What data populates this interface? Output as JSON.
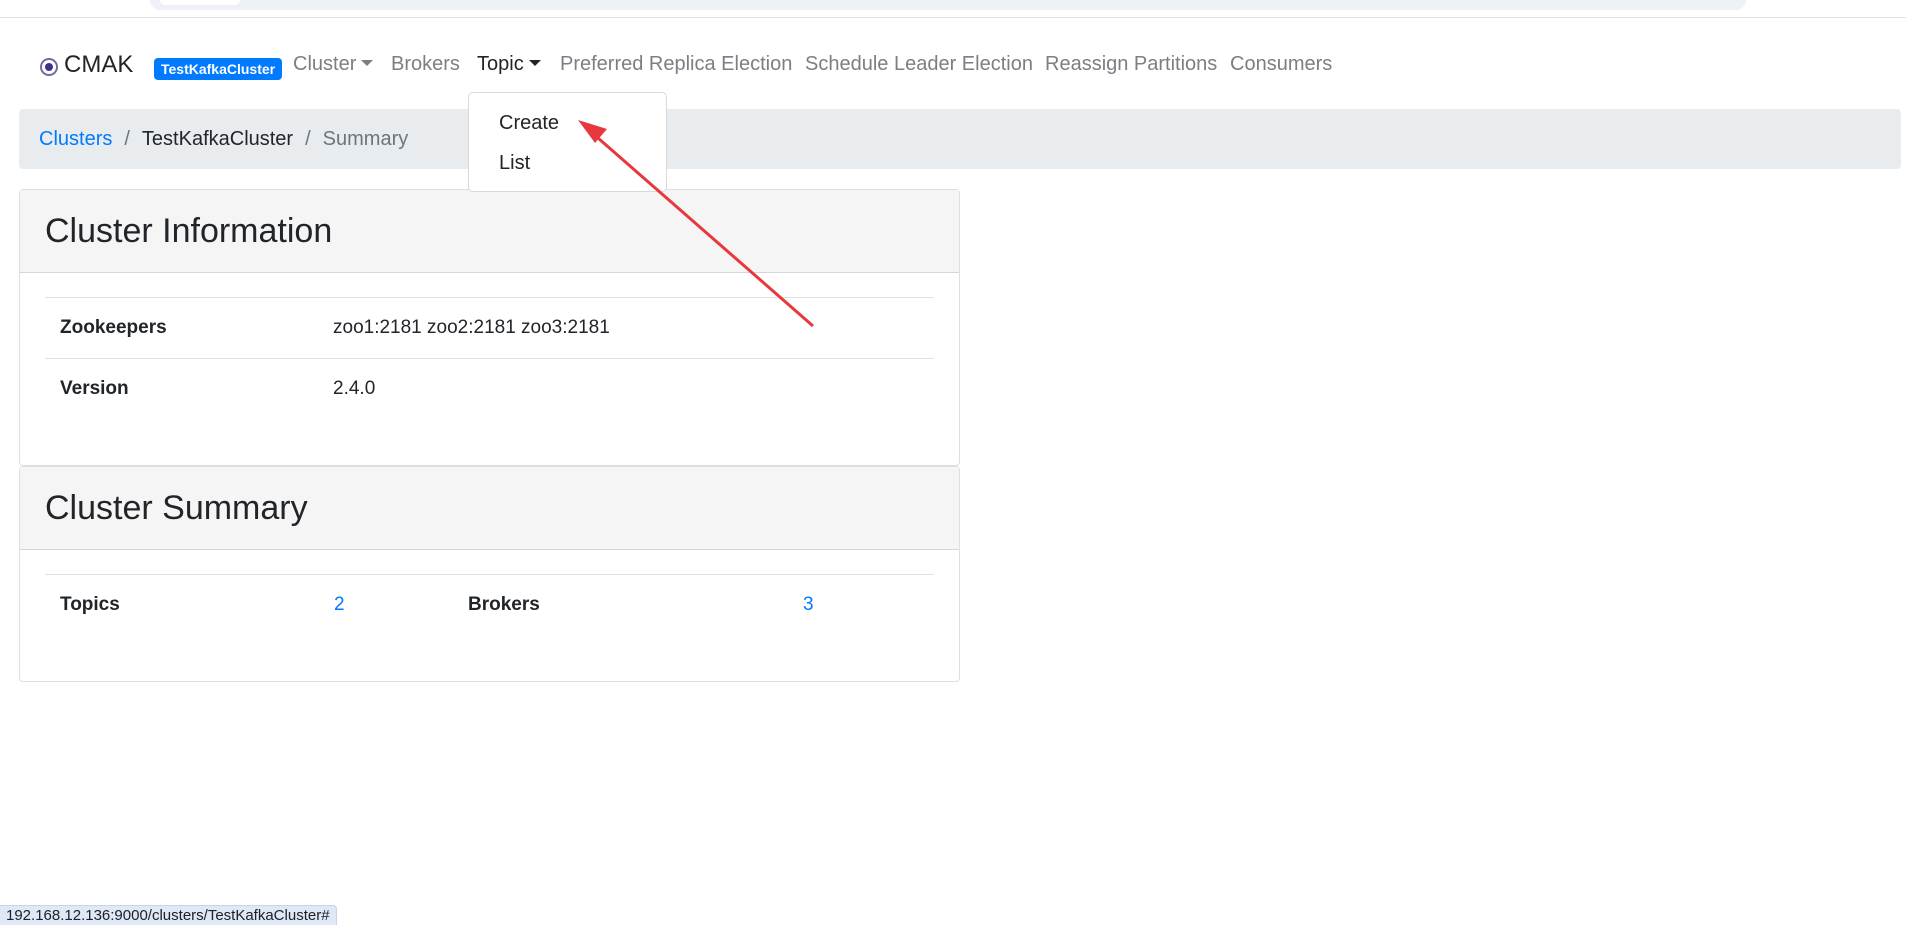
{
  "navbar": {
    "brand": "CMAK",
    "cluster_badge": "TestKafkaCluster",
    "items": [
      {
        "label": "Cluster"
      },
      {
        "label": "Brokers"
      },
      {
        "label": "Topic"
      },
      {
        "label": "Preferred Replica Election"
      },
      {
        "label": "Schedule Leader Election"
      },
      {
        "label": "Reassign Partitions"
      },
      {
        "label": "Consumers"
      }
    ],
    "topic_dropdown": [
      "Create",
      "List"
    ]
  },
  "breadcrumb": {
    "root": "Clusters",
    "sep": "/",
    "cluster": "TestKafkaCluster",
    "current": "Summary"
  },
  "cluster_info": {
    "title": "Cluster Information",
    "zookeepers_label": "Zookeepers",
    "zookeepers_value": "zoo1:2181 zoo2:2181 zoo3:2181",
    "version_label": "Version",
    "version_value": "2.4.0"
  },
  "cluster_summary": {
    "title": "Cluster Summary",
    "topics_label": "Topics",
    "topics_value": "2",
    "brokers_label": "Brokers",
    "brokers_value": "3"
  },
  "status_bar": {
    "url": "192.168.12.136:9000/clusters/TestKafkaCluster#"
  },
  "colors": {
    "link": "#007bff",
    "badge": "#007bff",
    "arrow": "#e8383d"
  }
}
